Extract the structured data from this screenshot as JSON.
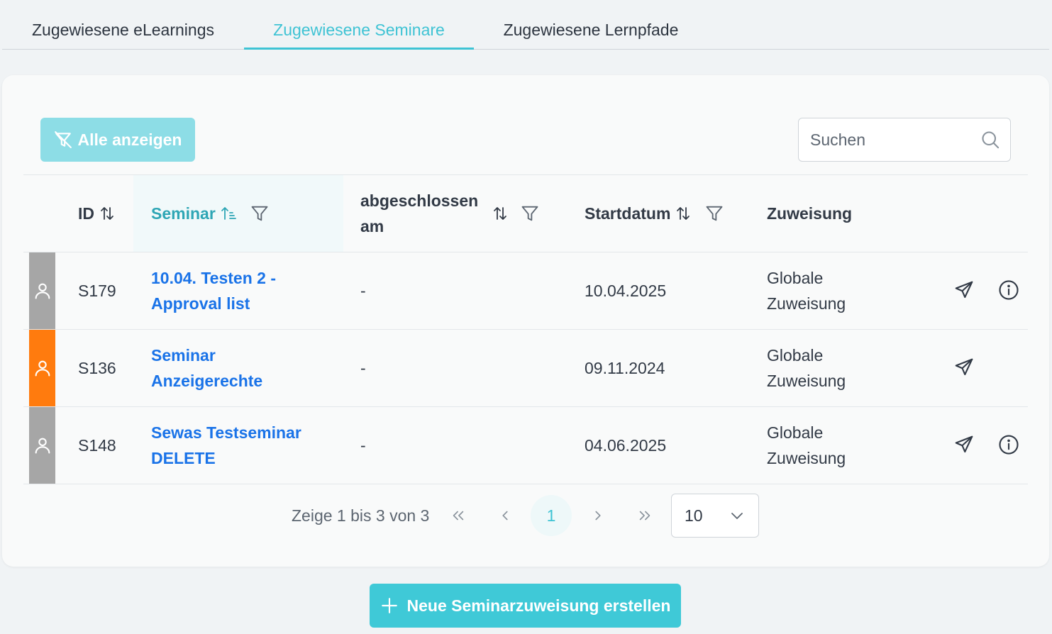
{
  "tabs": [
    {
      "label": "Zugewiesene eLearnings",
      "active": false
    },
    {
      "label": "Zugewiesene Seminare",
      "active": true
    },
    {
      "label": "Zugewiesene Lernpfade",
      "active": false
    }
  ],
  "toolbar": {
    "filter_button_label": "Alle anzeigen",
    "search_placeholder": "Suchen"
  },
  "table": {
    "columns": {
      "id": "ID",
      "seminar": "Seminar",
      "completed": "abgeschlossen am",
      "start_date": "Startdatum",
      "assignment": "Zuweisung"
    },
    "rows": [
      {
        "status_color": "#a6a6a6",
        "id": "S179",
        "seminar": "10.04. Testen 2 - Approval list",
        "completed": "-",
        "start_date": "10.04.2025",
        "assignment": "Globale Zuweisung",
        "has_info": true
      },
      {
        "status_color": "#ff7b0e",
        "id": "S136",
        "seminar": "Seminar Anzeigerechte",
        "completed": "-",
        "start_date": "09.11.2024",
        "assignment": "Globale Zuweisung",
        "has_info": false
      },
      {
        "status_color": "#a6a6a6",
        "id": "S148",
        "seminar": "Sewas Testseminar DELETE",
        "completed": "-",
        "start_date": "04.06.2025",
        "assignment": "Globale Zuweisung",
        "has_info": true
      }
    ]
  },
  "pagination": {
    "info": "Zeige 1 bis 3 von 3",
    "current_page": "1",
    "rows_per_page": "10"
  },
  "create_button_label": "Neue Seminarzuweisung erstellen",
  "colors": {
    "accent": "#3fc3d4",
    "link": "#1a73e8",
    "status_gray": "#a6a6a6",
    "status_orange": "#ff7b0e"
  }
}
